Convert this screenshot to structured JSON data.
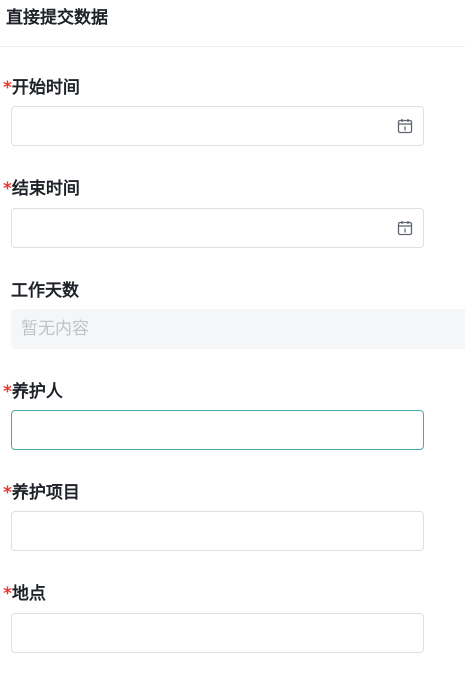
{
  "header": {
    "title": "直接提交数据"
  },
  "required_mark": "*",
  "fields": {
    "start_time": {
      "label": "开始时间",
      "value": "",
      "icon": "calendar-icon"
    },
    "end_time": {
      "label": "结束时间",
      "value": "",
      "icon": "calendar-icon"
    },
    "work_days": {
      "label": "工作天数",
      "empty_text": "暂无内容"
    },
    "maintainer": {
      "label": "养护人",
      "value": ""
    },
    "maintain_item": {
      "label": "养护项目",
      "value": ""
    },
    "location": {
      "label": "地点",
      "value": ""
    }
  },
  "colors": {
    "required": "#e53935",
    "focus_border": "#4aa9a8",
    "input_border": "#dcdfe6",
    "readonly_bg": "#f5f6f7",
    "placeholder": "#bfc3c9"
  }
}
